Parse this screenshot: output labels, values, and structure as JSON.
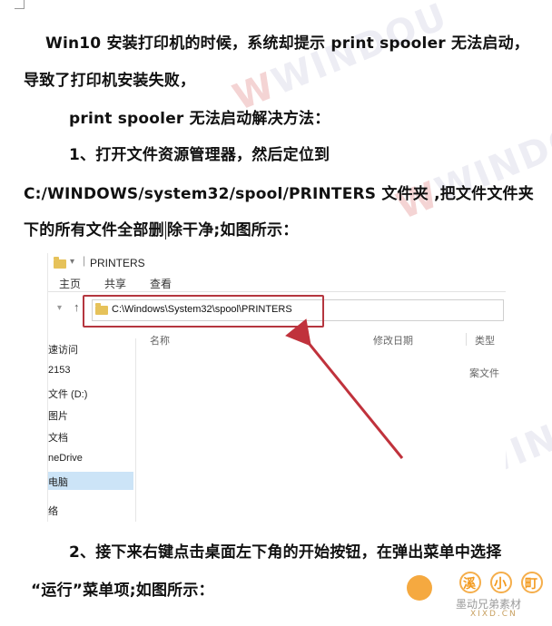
{
  "paragraphs": {
    "p1": "Win10 安装打印机的时候，系统却提示 print spooler 无法启动，",
    "p1b": "导致了打印机安装失败，",
    "p2": "print spooler 无法启动解决方法：",
    "p3": "1、打开文件资源管理器，然后定位到",
    "p3b": "C:/WINDOWS/system32/spool/PRINTERS 文件夹 ,把文件文件夹",
    "p3c_a": "下的所有文件全部删",
    "p3c_b": "除干净;如图所示：",
    "p4": "2、接下来右键点击桌面左下角的开始按钮，在弹出菜单中选择",
    "p4b": "“运行”菜单项;如图所示："
  },
  "screenshot": {
    "window_title": "PRINTERS",
    "ribbon_tabs": [
      "主页",
      "共享",
      "查看"
    ],
    "address": "C:\\Windows\\System32\\spool\\PRINTERS",
    "columns": {
      "name": "名称",
      "date": "修改日期",
      "type": "类型"
    },
    "partial_type": "案文件",
    "nav_items": [
      "速访问",
      "2153",
      "文件 (D:)",
      "图片",
      "文档",
      "neDrive",
      "电脑",
      "络"
    ],
    "selected_nav": "电脑"
  },
  "watermark": {
    "text": "WINDOU"
  },
  "logo": {
    "chars": [
      "溪",
      "小",
      "町"
    ],
    "caption": "墨动兄弟素材",
    "url": "XIXD.CN"
  },
  "colors": {
    "highlight_border": "#b5363f",
    "arrow": "#c0323c",
    "logo_orange": "#f39a1e"
  }
}
